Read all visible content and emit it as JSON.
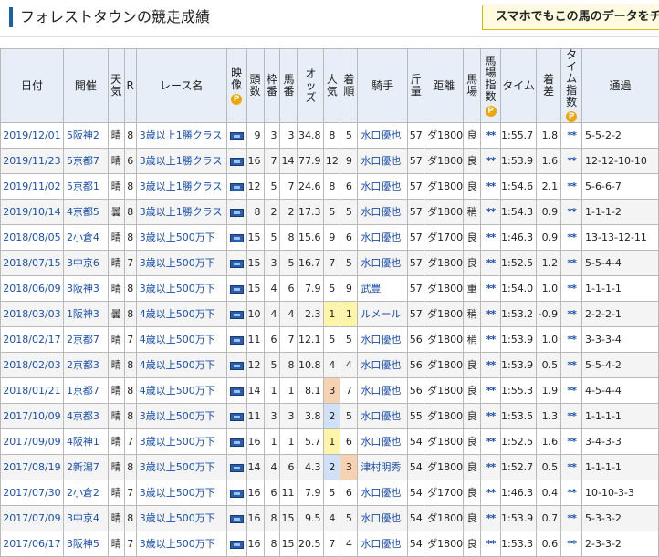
{
  "page": {
    "title": "フォレストタウンの競走成績",
    "promo": "スマホでもこの馬のデータをチェ"
  },
  "header": {
    "date": "日付",
    "venue": "開催",
    "weather": "天気",
    "race_no": "R",
    "race_name": "レース名",
    "video": "映像",
    "video_p": "P",
    "heads": "頭数",
    "frame": "枠番",
    "horse_no": "馬番",
    "odds": "オッズ",
    "popularity": "人気",
    "finish": "着順",
    "jockey": "騎手",
    "weight": "斤量",
    "distance": "距離",
    "track": "馬場",
    "track_index": "馬場指数",
    "track_index_p": "P",
    "time": "タイム",
    "margin": "着差",
    "time_index": "タイム指数",
    "time_index_p": "P",
    "passing": "通過"
  },
  "rows": [
    {
      "date": "2019/12/01",
      "venue": "5阪神2",
      "weather": "晴",
      "r": "8",
      "race": "3歳以上1勝クラス",
      "heads": "9",
      "frame": "3",
      "no": "3",
      "odds": "34.8",
      "pop": "8",
      "fin": "5",
      "jockey": "水口優也",
      "wt": "57",
      "dist": "ダ1800",
      "track": "良",
      "ti": "**",
      "time": "1:55.7",
      "margin": "1.8",
      "tdx": "**",
      "pass": "5-5-2-2"
    },
    {
      "date": "2019/11/23",
      "venue": "5京都7",
      "weather": "晴",
      "r": "6",
      "race": "3歳以上1勝クラス",
      "heads": "16",
      "frame": "7",
      "no": "14",
      "odds": "77.9",
      "pop": "12",
      "fin": "9",
      "jockey": "水口優也",
      "wt": "57",
      "dist": "ダ1800",
      "track": "良",
      "ti": "**",
      "time": "1:53.9",
      "margin": "1.6",
      "tdx": "**",
      "pass": "12-12-10-10"
    },
    {
      "date": "2019/11/02",
      "venue": "5京都1",
      "weather": "晴",
      "r": "8",
      "race": "3歳以上1勝クラス",
      "heads": "12",
      "frame": "5",
      "no": "7",
      "odds": "24.6",
      "pop": "8",
      "fin": "6",
      "jockey": "水口優也",
      "wt": "57",
      "dist": "ダ1800",
      "track": "良",
      "ti": "**",
      "time": "1:54.6",
      "margin": "2.1",
      "tdx": "**",
      "pass": "5-6-6-7"
    },
    {
      "date": "2019/10/14",
      "venue": "4京都5",
      "weather": "曇",
      "r": "8",
      "race": "3歳以上1勝クラス",
      "heads": "8",
      "frame": "2",
      "no": "2",
      "odds": "17.3",
      "pop": "5",
      "fin": "5",
      "jockey": "水口優也",
      "wt": "57",
      "dist": "ダ1800",
      "track": "稍",
      "ti": "**",
      "time": "1:54.3",
      "margin": "0.9",
      "tdx": "**",
      "pass": "1-1-1-2"
    },
    {
      "date": "2018/08/05",
      "venue": "2小倉4",
      "weather": "晴",
      "r": "8",
      "race": "3歳以上500万下",
      "heads": "15",
      "frame": "5",
      "no": "8",
      "odds": "15.6",
      "pop": "9",
      "fin": "6",
      "jockey": "水口優也",
      "wt": "57",
      "dist": "ダ1700",
      "track": "良",
      "ti": "**",
      "time": "1:46.3",
      "margin": "0.9",
      "tdx": "**",
      "pass": "13-13-12-11"
    },
    {
      "date": "2018/07/15",
      "venue": "3中京6",
      "weather": "晴",
      "r": "7",
      "race": "3歳以上500万下",
      "heads": "15",
      "frame": "3",
      "no": "5",
      "odds": "16.7",
      "pop": "7",
      "fin": "5",
      "jockey": "水口優也",
      "wt": "57",
      "dist": "ダ1800",
      "track": "良",
      "ti": "**",
      "time": "1:52.5",
      "margin": "1.2",
      "tdx": "**",
      "pass": "5-5-4-4"
    },
    {
      "date": "2018/06/09",
      "venue": "3阪神3",
      "weather": "晴",
      "r": "8",
      "race": "3歳以上500万下",
      "heads": "15",
      "frame": "4",
      "no": "6",
      "odds": "7.9",
      "pop": "5",
      "fin": "9",
      "jockey": "武豊",
      "wt": "57",
      "dist": "ダ1800",
      "track": "重",
      "ti": "**",
      "time": "1:54.0",
      "margin": "1.0",
      "tdx": "**",
      "pass": "1-1-1-1"
    },
    {
      "date": "2018/03/03",
      "venue": "1阪神3",
      "weather": "曇",
      "r": "8",
      "race": "4歳以上500万下",
      "heads": "10",
      "frame": "4",
      "no": "4",
      "odds": "2.3",
      "pop": "1",
      "fin": "1",
      "jockey": "ルメール",
      "wt": "57",
      "dist": "ダ1800",
      "track": "稍",
      "ti": "**",
      "time": "1:53.2",
      "margin": "-0.9",
      "tdx": "**",
      "pass": "2-2-2-1"
    },
    {
      "date": "2018/02/17",
      "venue": "2京都7",
      "weather": "晴",
      "r": "7",
      "race": "4歳以上500万下",
      "heads": "11",
      "frame": "6",
      "no": "7",
      "odds": "12.1",
      "pop": "5",
      "fin": "5",
      "jockey": "水口優也",
      "wt": "56",
      "dist": "ダ1800",
      "track": "稍",
      "ti": "**",
      "time": "1:53.9",
      "margin": "1.0",
      "tdx": "**",
      "pass": "3-3-3-4"
    },
    {
      "date": "2018/02/03",
      "venue": "2京都3",
      "weather": "晴",
      "r": "8",
      "race": "4歳以上500万下",
      "heads": "12",
      "frame": "5",
      "no": "8",
      "odds": "10.8",
      "pop": "4",
      "fin": "4",
      "jockey": "水口優也",
      "wt": "56",
      "dist": "ダ1800",
      "track": "良",
      "ti": "**",
      "time": "1:53.9",
      "margin": "0.5",
      "tdx": "**",
      "pass": "5-5-4-2"
    },
    {
      "date": "2018/01/21",
      "venue": "1京都7",
      "weather": "晴",
      "r": "8",
      "race": "4歳以上500万下",
      "heads": "14",
      "frame": "1",
      "no": "1",
      "odds": "8.1",
      "pop": "3",
      "fin": "7",
      "jockey": "水口優也",
      "wt": "56",
      "dist": "ダ1800",
      "track": "良",
      "ti": "**",
      "time": "1:55.3",
      "margin": "1.9",
      "tdx": "**",
      "pass": "4-5-4-4"
    },
    {
      "date": "2017/10/09",
      "venue": "4京都3",
      "weather": "晴",
      "r": "8",
      "race": "3歳以上500万下",
      "heads": "11",
      "frame": "3",
      "no": "3",
      "odds": "3.8",
      "pop": "2",
      "fin": "5",
      "jockey": "水口優也",
      "wt": "55",
      "dist": "ダ1800",
      "track": "良",
      "ti": "**",
      "time": "1:53.5",
      "margin": "1.3",
      "tdx": "**",
      "pass": "1-1-1-1"
    },
    {
      "date": "2017/09/09",
      "venue": "4阪神1",
      "weather": "晴",
      "r": "7",
      "race": "3歳以上500万下",
      "heads": "16",
      "frame": "1",
      "no": "1",
      "odds": "5.7",
      "pop": "1",
      "fin": "6",
      "jockey": "水口優也",
      "wt": "54",
      "dist": "ダ1800",
      "track": "良",
      "ti": "**",
      "time": "1:52.5",
      "margin": "1.6",
      "tdx": "**",
      "pass": "3-4-3-3"
    },
    {
      "date": "2017/08/19",
      "venue": "2新潟7",
      "weather": "晴",
      "r": "8",
      "race": "3歳以上500万下",
      "heads": "14",
      "frame": "4",
      "no": "6",
      "odds": "4.3",
      "pop": "2",
      "fin": "3",
      "jockey": "津村明秀",
      "wt": "54",
      "dist": "ダ1800",
      "track": "良",
      "ti": "**",
      "time": "1:52.7",
      "margin": "0.5",
      "tdx": "**",
      "pass": "1-1-1-1"
    },
    {
      "date": "2017/07/30",
      "venue": "2小倉2",
      "weather": "晴",
      "r": "7",
      "race": "3歳以上500万下",
      "heads": "16",
      "frame": "6",
      "no": "11",
      "odds": "7.9",
      "pop": "5",
      "fin": "6",
      "jockey": "水口優也",
      "wt": "54",
      "dist": "ダ1700",
      "track": "良",
      "ti": "**",
      "time": "1:46.3",
      "margin": "0.4",
      "tdx": "**",
      "pass": "10-10-3-3"
    },
    {
      "date": "2017/07/09",
      "venue": "3中京4",
      "weather": "晴",
      "r": "8",
      "race": "3歳以上500万下",
      "heads": "16",
      "frame": "8",
      "no": "15",
      "odds": "9.5",
      "pop": "4",
      "fin": "5",
      "jockey": "水口優也",
      "wt": "54",
      "dist": "ダ1800",
      "track": "良",
      "ti": "**",
      "time": "1:53.9",
      "margin": "0.7",
      "tdx": "**",
      "pass": "5-3-3-2"
    },
    {
      "date": "2017/06/17",
      "venue": "3阪神5",
      "weather": "晴",
      "r": "7",
      "race": "3歳以上500万下",
      "heads": "16",
      "frame": "8",
      "no": "15",
      "odds": "20.5",
      "pop": "7",
      "fin": "4",
      "jockey": "水口優也",
      "wt": "54",
      "dist": "ダ1800",
      "track": "良",
      "ti": "**",
      "time": "1:53.3",
      "margin": "0.6",
      "tdx": "**",
      "pass": "2-3-3-2"
    }
  ]
}
